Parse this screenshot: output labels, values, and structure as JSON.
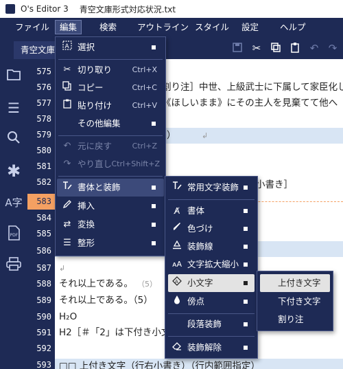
{
  "titlebar": {
    "app": "O's Editor 3",
    "document": "青空文庫形式対応状況.txt"
  },
  "menubar": [
    "ファイル",
    "編集",
    "検索",
    "アウトライン",
    "スタイル",
    "設定",
    "ヘルプ"
  ],
  "tab": {
    "title": "青空文庫"
  },
  "toolbar_icons": [
    "save-icon",
    "cut-icon",
    "copy-icon",
    "paste-icon",
    "undo-icon",
    "redo-icon"
  ],
  "sidebar_icons": [
    "folder-icon",
    "list-icon",
    "search-icon",
    "asterisk-icon",
    "ruby-icon",
    "pdf-icon",
    "print-icon"
  ],
  "line_numbers": [
    "575",
    "576",
    "577",
    "578",
    "579",
    "580",
    "581",
    "582",
    "583",
    "584",
    "585",
    "586",
    "587",
    "588",
    "589",
    "590",
    "591",
    "592",
    "593"
  ],
  "current_line": "583",
  "editor_lines": {
    "l576": "割り注］中世、上級武士に下属して家臣化し",
    "l577": "《ほしいまま》にその主人を見棄てて他へ",
    "l579": "書き）",
    "l582": "小書き］",
    "l588": "それ以上である。",
    "l588_mark": "（5）",
    "l589": "それ以上である。（5）",
    "l590": "H₂O",
    "l591": "H2［＃「2」は下付き小文",
    "l593": "□□ 上付き文字（行右小書き）（行内範囲指定）",
    "return_mark": "↲"
  },
  "edit_menu": {
    "select": "選択",
    "cut": "切り取り",
    "cut_sc": "Ctrl+X",
    "copy": "コピー",
    "copy_sc": "Ctrl+C",
    "paste": "貼り付け",
    "paste_sc": "Ctrl+V",
    "other": "その他編集",
    "undo": "元に戻す",
    "undo_sc": "Ctrl+Z",
    "redo": "やり直し",
    "redo_sc": "Ctrl+Shift+Z",
    "style": "書体と装飾",
    "insert": "挿入",
    "convert": "変換",
    "format": "整形"
  },
  "style_menu": {
    "common": "常用文字装飾",
    "font": "書体",
    "color": "色づけ",
    "underline": "装飾線",
    "scale": "文字拡大縮小",
    "small": "小文字",
    "emphasis": "傍点",
    "paragraph": "段落装飾",
    "clear": "装飾解除"
  },
  "small_menu": {
    "superscript": "上付き文字",
    "subscript": "下付き文字",
    "warichu": "割り注"
  }
}
